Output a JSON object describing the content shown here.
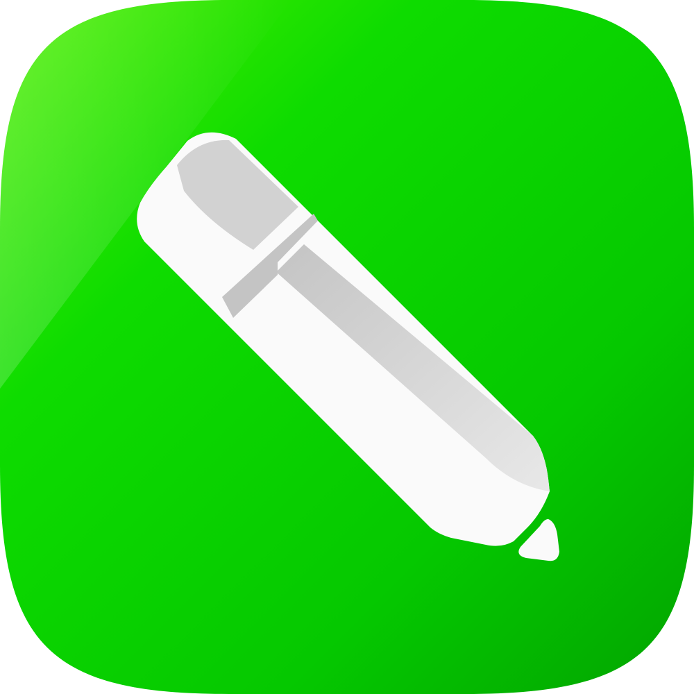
{
  "app_icon": {
    "name": "pencil-app-icon",
    "colors": {
      "background_top_left": "#3fe800",
      "background_mid": "#06d400",
      "background_bottom_right": "#03a800",
      "pencil_white": "#fafafa",
      "pencil_shade": "#cfcfcf",
      "pencil_light_shade": "#e6e6e6"
    },
    "icon": "pencil-icon"
  }
}
